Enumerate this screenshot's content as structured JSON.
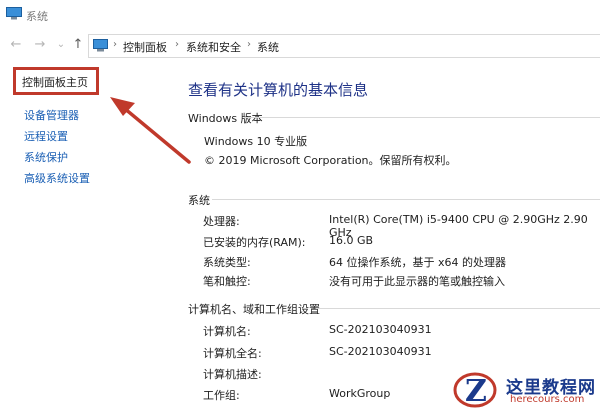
{
  "window": {
    "title": "系统"
  },
  "nav": {
    "back": "←",
    "forward": "→",
    "dropdown": "⌄",
    "up": "↑"
  },
  "breadcrumb": [
    {
      "label": "控制面板"
    },
    {
      "label": "系统和安全"
    },
    {
      "label": "系统"
    }
  ],
  "breadcrumb_separator": "›",
  "sidebar": {
    "home": "控制面板主页",
    "items": [
      {
        "label": "设备管理器"
      },
      {
        "label": "远程设置"
      },
      {
        "label": "系统保护"
      },
      {
        "label": "高级系统设置"
      }
    ]
  },
  "main": {
    "title": "查看有关计算机的基本信息",
    "windows_edition": {
      "heading": "Windows 版本",
      "edition": "Windows 10 专业版",
      "copyright": "© 2019 Microsoft Corporation。保留所有权利。"
    },
    "system": {
      "heading": "系统",
      "rows": [
        {
          "label": "处理器:",
          "value": "Intel(R) Core(TM) i5-9400 CPU @ 2.90GHz   2.90 GHz"
        },
        {
          "label": "已安装的内存(RAM):",
          "value": "16.0 GB"
        },
        {
          "label": "系统类型:",
          "value": "64 位操作系统，基于 x64 的处理器"
        },
        {
          "label": "笔和触控:",
          "value": "没有可用于此显示器的笔或触控输入"
        }
      ]
    },
    "computer": {
      "heading": "计算机名、域和工作组设置",
      "rows": [
        {
          "label": "计算机名:",
          "value": "SC-202103040931"
        },
        {
          "label": "计算机全名:",
          "value": "SC-202103040931"
        },
        {
          "label": "计算机描述:",
          "value": ""
        },
        {
          "label": "工作组:",
          "value": "WorkGroup"
        }
      ]
    }
  },
  "watermark": {
    "name": "这里教程网",
    "url": "herecours.com"
  },
  "colors": {
    "accent_title": "#1e3287",
    "link": "#1a5fb4",
    "annotation": "#c0392b"
  }
}
